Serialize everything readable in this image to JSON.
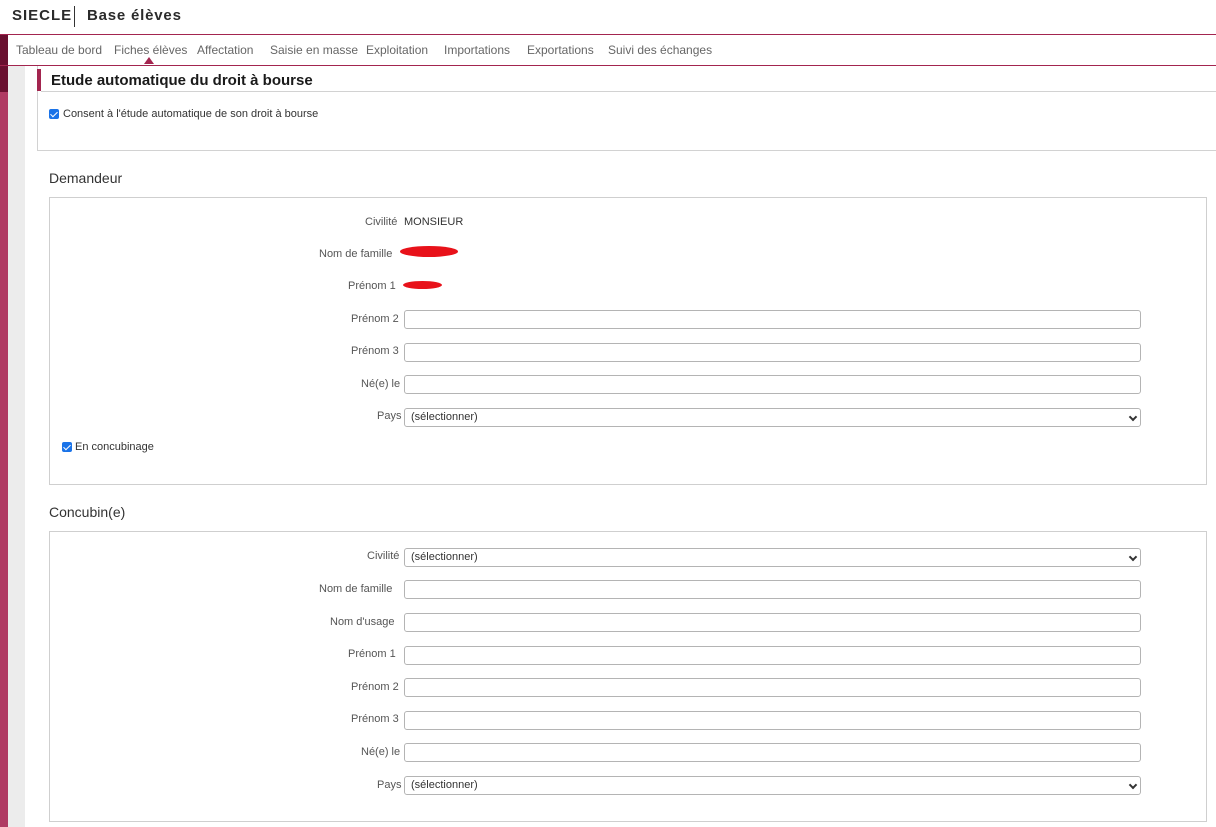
{
  "header": {
    "app_name": "SIECLE",
    "module": "Base élèves"
  },
  "nav": {
    "items": [
      "Tableau de bord",
      "Fiches élèves",
      "Affectation",
      "Saisie en masse",
      "Exploitation",
      "Importations",
      "Exportations",
      "Suivi des échanges"
    ],
    "active": "Fiches élèves"
  },
  "section": {
    "title": "Etude automatique du droit à bourse",
    "consent_label": "Consent à l'étude automatique de son droit à bourse",
    "consent_checked": true
  },
  "demandeur": {
    "title": "Demandeur",
    "civilite_label": "Civilité",
    "civilite_value": "MONSIEUR",
    "nom_label": "Nom de famille",
    "prenom1_label": "Prénom 1",
    "prenom2_label": "Prénom 2",
    "prenom3_label": "Prénom 3",
    "ne_le_label": "Né(e) le",
    "pays_label": "Pays",
    "pays_value": "(sélectionner)",
    "concubinage_label": "En concubinage",
    "concubinage_checked": true
  },
  "concubin": {
    "title": "Concubin(e)",
    "civilite_label": "Civilité",
    "civilite_value": "(sélectionner)",
    "nom_label": "Nom de famille",
    "nom_usage_label": "Nom d'usage",
    "prenom1_label": "Prénom 1",
    "prenom2_label": "Prénom 2",
    "prenom3_label": "Prénom 3",
    "ne_le_label": "Né(e) le",
    "pays_label": "Pays",
    "pays_value": "(sélectionner)"
  },
  "colors": {
    "brand": "#a3254f",
    "brand_dark": "#6a1030",
    "checkbox": "#1a73e8",
    "redaction": "#e8121a"
  }
}
